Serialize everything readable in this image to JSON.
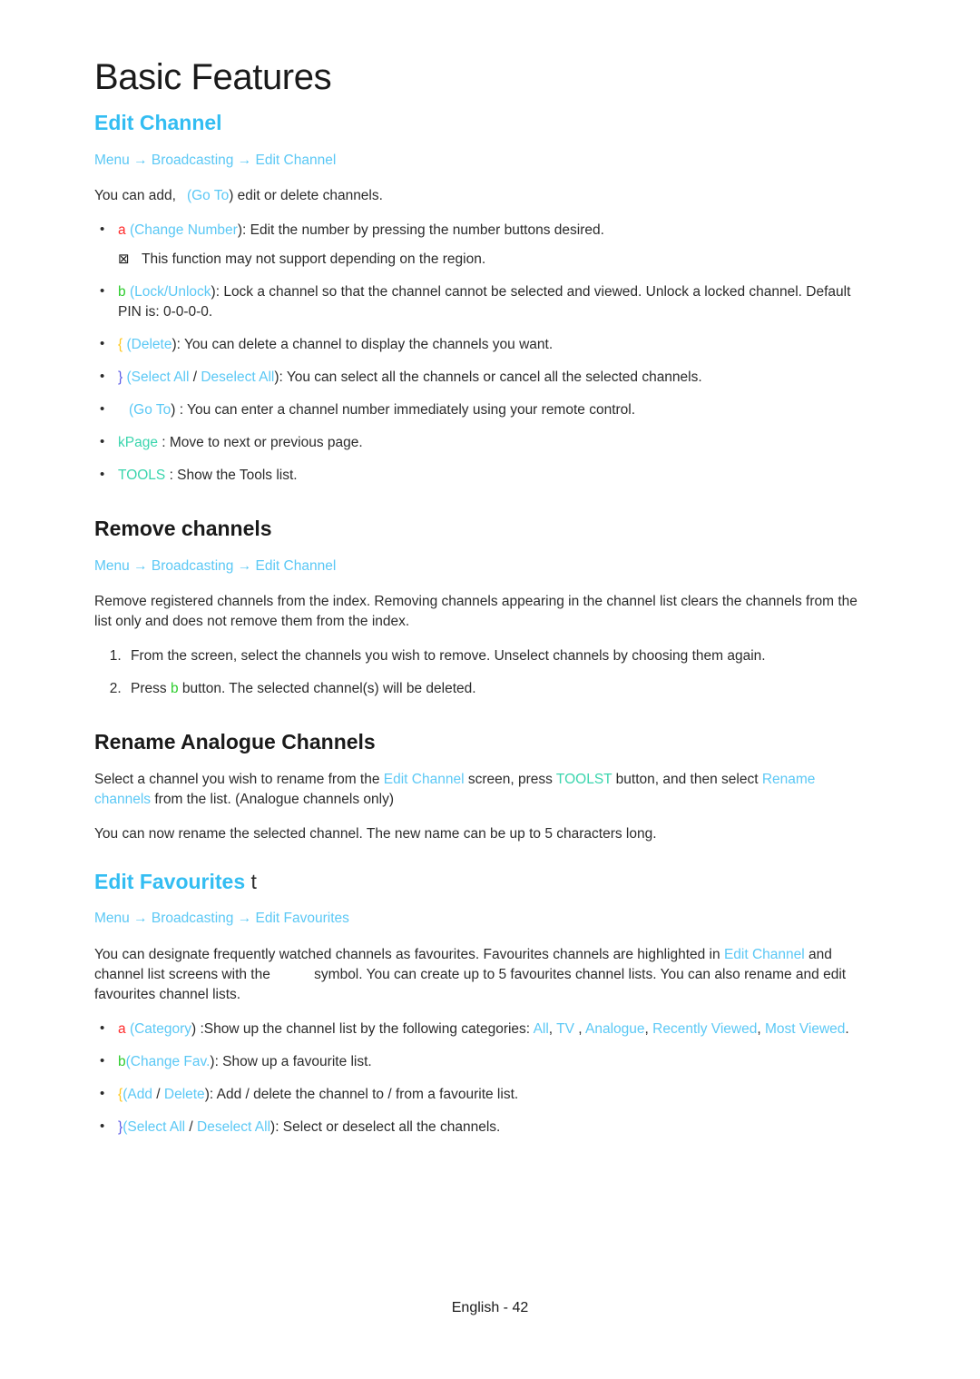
{
  "page": {
    "title": "Basic Features",
    "footer": "English - 42"
  },
  "sections": {
    "edit_channel": {
      "heading": "Edit Channel",
      "breadcrumb": {
        "menu": "Menu",
        "broadcasting": "Broadcasting",
        "target": "Edit Channel",
        "arrow": "→"
      },
      "intro_pre": "You can add,",
      "intro_goto": "Go To",
      "intro_post": ") edit or delete channels.",
      "bullets": [
        {
          "key": "a",
          "key_color": "#ff2a2a",
          "label": "Change Number",
          "text": "): Edit the number by pressing the number buttons desired."
        },
        {
          "key": "b",
          "key_color": "#2ecc2e",
          "label": "Lock/Unlock",
          "text": "): Lock a channel so that the channel cannot be selected and viewed. Unlock a locked channel. Default PIN is: 0-0-0-0."
        },
        {
          "key": "{",
          "key_color": "#ffc81e",
          "label": "Delete",
          "text": "): You can delete a channel to display the channels you want."
        },
        {
          "key": "}",
          "key_color": "#5a5ae6",
          "label": "Select All",
          "label2": "Deselect All",
          "separator": " / ",
          "text": "): You can select all the channels or cancel all the selected channels."
        },
        {
          "key": "",
          "key_color": "#2b2b2b",
          "label": "Go To",
          "text": ") : You can enter a channel number immediately using your remote control."
        },
        {
          "key": "",
          "key_color": "#2b2b2b",
          "plain_teal": "kPage",
          "text": " : Move to next or previous page."
        },
        {
          "key": "",
          "key_color": "#2b2b2b",
          "plain_teal": "TOOLS",
          "text": " : Show the Tools list."
        }
      ],
      "note": {
        "symbol": "⊠",
        "text": "This function may not support depending on the region."
      }
    },
    "remove_channels": {
      "heading": "Remove channels",
      "breadcrumb": {
        "menu": "Menu",
        "broadcasting": "Broadcasting",
        "target": "Edit Channel",
        "arrow": "→"
      },
      "body": "Remove registered channels from the index. Removing channels appearing in the channel list clears the channels from the list only and does not remove them from the index.",
      "steps": [
        {
          "text": "From the screen, select the channels you wish to remove. Unselect channels by choosing them again."
        },
        {
          "pre": "Press ",
          "key": "b",
          "key_color": "#2ecc2e",
          "post": " button. The selected channel(s) will be deleted."
        }
      ]
    },
    "rename_analogue": {
      "heading": "Rename Analogue Channels",
      "para1_a": "Select a channel you wish to rename from the ",
      "para1_link1": "Edit Channel",
      "para1_b": " screen, press ",
      "para1_tools": "TOOLST",
      "para1_c": " button, and then select ",
      "para1_link2": "Rename channels",
      "para1_d": " from the list. (Analogue channels only)",
      "para2": "You can now rename the selected channel. The new name can be up to 5 characters long."
    },
    "edit_favourites": {
      "heading": "Edit Favourites",
      "heading_suffix": "t",
      "breadcrumb": {
        "menu": "Menu",
        "broadcasting": "Broadcasting",
        "target": "Edit Favourites",
        "arrow": "→"
      },
      "para_a": "You can designate frequently watched channels as favourites. Favourites channels are highlighted in ",
      "para_link": "Edit Channel",
      "para_b": " and channel list screens with the ",
      "para_c": "symbol. You can create up to 5 favourites channel lists. You can also rename and edit favourites channel lists.",
      "bullets": [
        {
          "key": "a",
          "key_color": "#ff2a2a",
          "label": "Category",
          "text": " :Show up the channel list by the following categories: ",
          "categories": [
            "All",
            "TV ",
            "Analogue",
            "Recently Viewed",
            "Most Viewed"
          ],
          "tail": "."
        },
        {
          "key": "b",
          "key_color": "#2ecc2e",
          "label": "Change Fav.",
          "text": "): Show up a favourite list."
        },
        {
          "key": "{",
          "key_color": "#ffc81e",
          "label": "Add",
          "label2": "Delete",
          "separator": " / ",
          "text": "): Add / delete the channel to / from a favourite list."
        },
        {
          "key": "}",
          "key_color": "#5a5ae6",
          "label": "Select All",
          "label2": "Deselect All",
          "separator": " / ",
          "text": "): Select or deselect all the channels."
        }
      ]
    }
  },
  "colors": {
    "heading_blue": "#33bdf2",
    "link_cyan": "#5bc8f5",
    "teal": "#3ad5ad",
    "red": "#ff2a2a",
    "green": "#2ecc2e",
    "yellow": "#ffc81e",
    "indigo": "#5a5ae6",
    "text": "#2b2b2b"
  }
}
